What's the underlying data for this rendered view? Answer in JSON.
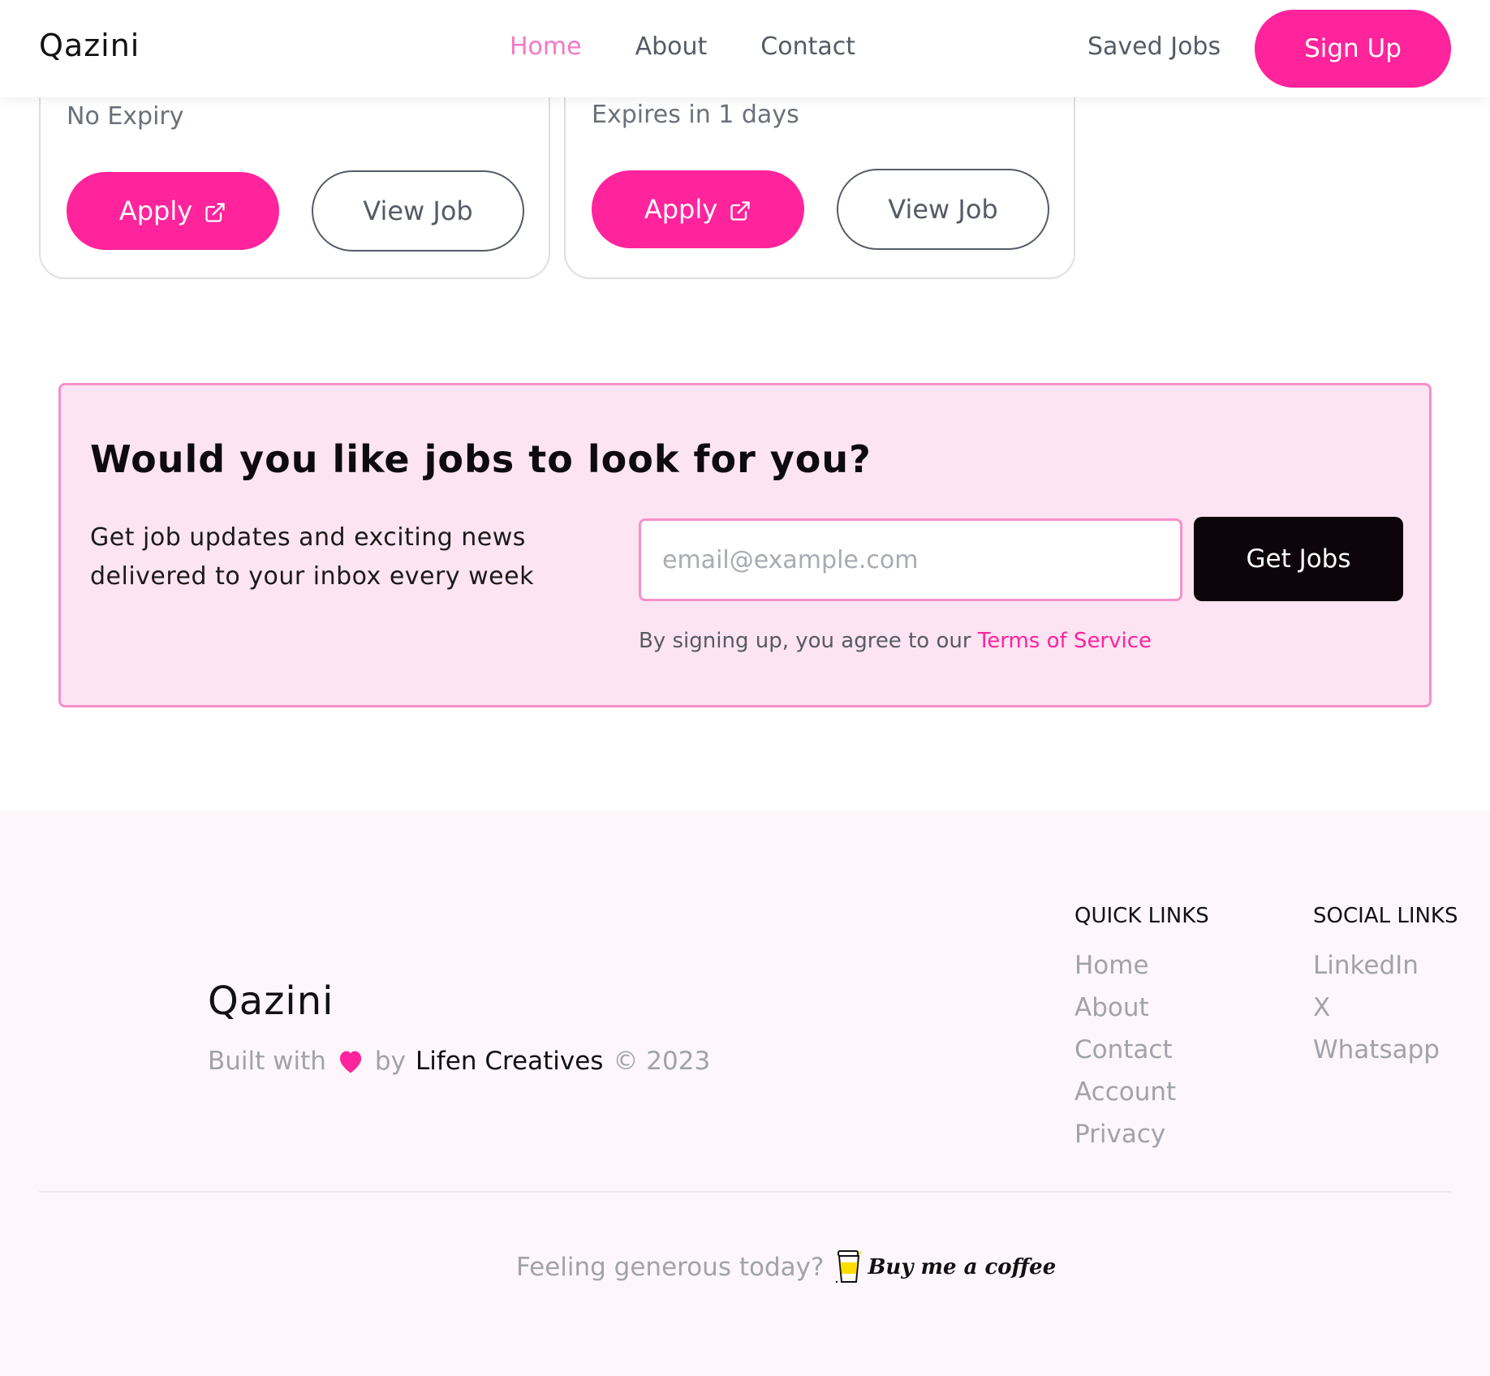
{
  "nav": {
    "logo": "Qazini",
    "links": [
      "Home",
      "About",
      "Contact"
    ],
    "saved_jobs": "Saved Jobs",
    "signup": "Sign Up",
    "colors": {
      "accent": "#ff239c",
      "active_link": "#f478c4"
    }
  },
  "jobs": [
    {
      "expiry": "No Expiry",
      "apply": "Apply",
      "view": "View Job"
    },
    {
      "expiry": "Expires in 1 days",
      "apply": "Apply",
      "view": "View Job"
    }
  ],
  "newsletter": {
    "title": "Would you like jobs to look for you?",
    "description": "Get job updates and exciting news delivered to your inbox every week",
    "email_placeholder": "email@example.com",
    "button": "Get Jobs",
    "terms_prefix": "By signing up, you agree to our",
    "terms_link": "Terms of Service"
  },
  "footer": {
    "logo": "Qazini",
    "built_with": "Built with",
    "by": "by",
    "company": "Lifen Creatives",
    "copyright": "© 2023",
    "quick_links_title": "QUICK LINKS",
    "quick_links": [
      "Home",
      "About",
      "Contact",
      "Account",
      "Privacy"
    ],
    "social_links_title": "SOCIAL LINKS",
    "social_links": [
      "LinkedIn",
      "X",
      "Whatsapp"
    ],
    "generous": "Feeling generous today?",
    "bmc": "Buy me a coffee"
  }
}
